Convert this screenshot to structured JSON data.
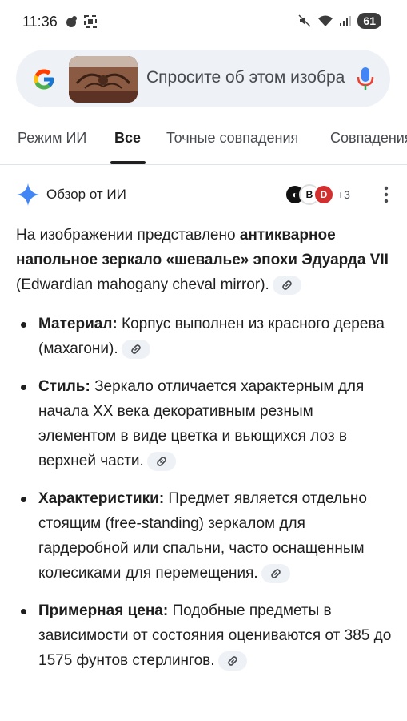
{
  "status_bar": {
    "time": "11:36",
    "battery": "61"
  },
  "search": {
    "placeholder": "Спросите об этом изобра"
  },
  "tabs": [
    {
      "label": "Режим ИИ"
    },
    {
      "label": "Все"
    },
    {
      "label": "Точные совпадения"
    },
    {
      "label": "Совпадения"
    }
  ],
  "ai_overview": {
    "title": "Обзор от ИИ",
    "sources_more": "+3",
    "intro": {
      "p1": "На изображении представлено ",
      "b1": "антикварное напольное зеркало «шевалье» эпохи Эдуарда VII",
      "p2": " (Edwardian mahogany cheval mirror)."
    },
    "bullets": [
      {
        "term": "Материал:",
        "text": " Корпус выполнен из красного дерева (махагони)."
      },
      {
        "term": "Стиль:",
        "text": " Зеркало отличается характерным для начала XX века декоративным резным элементом в виде цветка и вьющихся лоз в верхней части."
      },
      {
        "term": "Характеристики:",
        "text": " Предмет является отдельно стоящим (free-standing) зеркалом для гардеробной или спальни, часто оснащенным колесиками для перемещения."
      },
      {
        "term": "Примерная цена:",
        "text": " Подобные предметы в зависимости от состояния оцениваются от 385 до 1575 фунтов стерлингов."
      }
    ]
  },
  "colors": {
    "accent_blue": "#4285f4",
    "chip_bg": "#eef1f6"
  }
}
